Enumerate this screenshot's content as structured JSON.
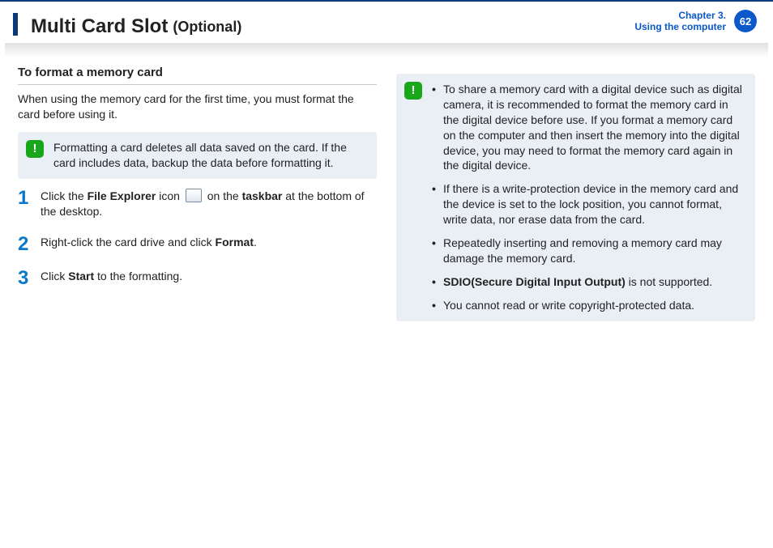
{
  "header": {
    "title": "Multi Card Slot",
    "subtitle": "(Optional)",
    "chapter_line1": "Chapter 3.",
    "chapter_line2": "Using the computer",
    "page_number": "62"
  },
  "left": {
    "section_title": "To format a memory card",
    "intro": "When using the memory card for the first time, you must format the card before using it.",
    "warning": "Formatting a card deletes all data saved on the card. If the card includes data, backup the data before formatting it.",
    "steps": [
      {
        "n": "1",
        "pre": "Click the ",
        "b1": "File Explorer",
        "mid": " icon ",
        "post": " on the ",
        "b2": "taskbar",
        "tail": " at the bottom of the desktop.",
        "has_icon": true
      },
      {
        "n": "2",
        "pre": "Right-click the card drive and click ",
        "b1": "Format",
        "mid": ".",
        "post": "",
        "b2": "",
        "tail": "",
        "has_icon": false
      },
      {
        "n": "3",
        "pre": "Click ",
        "b1": "Start",
        "mid": " to the formatting.",
        "post": "",
        "b2": "",
        "tail": "",
        "has_icon": false
      }
    ]
  },
  "right": {
    "notes": [
      {
        "text": "To share a memory card with a digital device such as digital camera, it is recommended to format the memory card in the digital device before use. If you format a memory card on the computer and then insert the memory into the digital device, you may need to format the memory card again in the digital device."
      },
      {
        "text": "If there is a write-protection device in the memory card and the device is set to the lock position, you cannot format, write data, nor erase data from the card."
      },
      {
        "text": "Repeatedly inserting and removing a memory card may damage the memory card."
      },
      {
        "bold": "SDIO(Secure Digital Input Output)",
        "text": " is not supported."
      },
      {
        "text": "You cannot read or write copyright-protected data."
      }
    ]
  }
}
